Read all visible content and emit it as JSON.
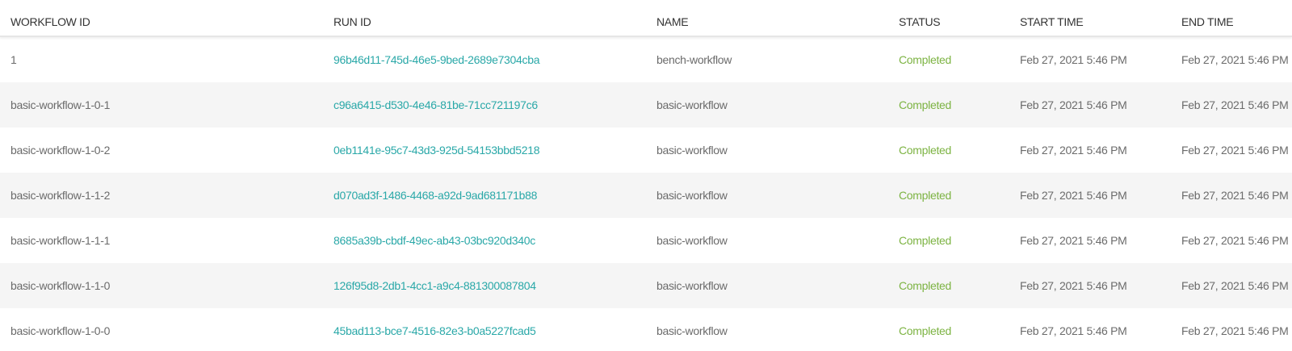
{
  "columns": {
    "workflow_id": "WORKFLOW ID",
    "run_id": "RUN ID",
    "name": "NAME",
    "status": "STATUS",
    "start_time": "START TIME",
    "end_time": "END TIME"
  },
  "colors": {
    "link": "#2aa8a8",
    "status_completed": "#7cb342",
    "row_alt": "#f5f5f5",
    "text": "#6b6b6b"
  },
  "rows": [
    {
      "workflow_id": "1",
      "run_id": "96b46d11-745d-46e5-9bed-2689e7304cba",
      "name": "bench-workflow",
      "status": "Completed",
      "start_time": "Feb 27, 2021 5:46 PM",
      "end_time": "Feb 27, 2021 5:46 PM"
    },
    {
      "workflow_id": "basic-workflow-1-0-1",
      "run_id": "c96a6415-d530-4e46-81be-71cc721197c6",
      "name": "basic-workflow",
      "status": "Completed",
      "start_time": "Feb 27, 2021 5:46 PM",
      "end_time": "Feb 27, 2021 5:46 PM"
    },
    {
      "workflow_id": "basic-workflow-1-0-2",
      "run_id": "0eb1141e-95c7-43d3-925d-54153bbd5218",
      "name": "basic-workflow",
      "status": "Completed",
      "start_time": "Feb 27, 2021 5:46 PM",
      "end_time": "Feb 27, 2021 5:46 PM"
    },
    {
      "workflow_id": "basic-workflow-1-1-2",
      "run_id": "d070ad3f-1486-4468-a92d-9ad681171b88",
      "name": "basic-workflow",
      "status": "Completed",
      "start_time": "Feb 27, 2021 5:46 PM",
      "end_time": "Feb 27, 2021 5:46 PM"
    },
    {
      "workflow_id": "basic-workflow-1-1-1",
      "run_id": "8685a39b-cbdf-49ec-ab43-03bc920d340c",
      "name": "basic-workflow",
      "status": "Completed",
      "start_time": "Feb 27, 2021 5:46 PM",
      "end_time": "Feb 27, 2021 5:46 PM"
    },
    {
      "workflow_id": "basic-workflow-1-1-0",
      "run_id": "126f95d8-2db1-4cc1-a9c4-881300087804",
      "name": "basic-workflow",
      "status": "Completed",
      "start_time": "Feb 27, 2021 5:46 PM",
      "end_time": "Feb 27, 2021 5:46 PM"
    },
    {
      "workflow_id": "basic-workflow-1-0-0",
      "run_id": "45bad113-bce7-4516-82e3-b0a5227fcad5",
      "name": "basic-workflow",
      "status": "Completed",
      "start_time": "Feb 27, 2021 5:46 PM",
      "end_time": "Feb 27, 2021 5:46 PM"
    }
  ]
}
